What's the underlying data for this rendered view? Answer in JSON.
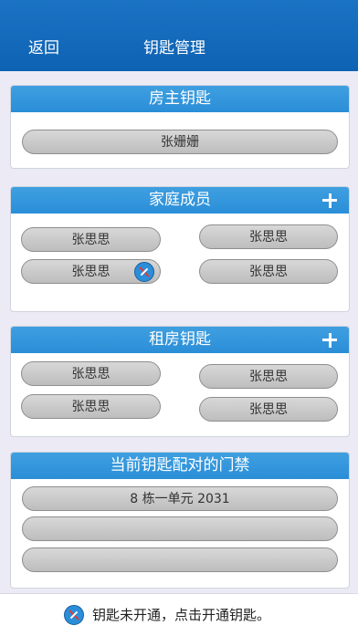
{
  "header": {
    "back_label": "返回",
    "title": "钥匙管理"
  },
  "owner_key": {
    "title": "房主钥匙",
    "members": [
      "张姗姗"
    ]
  },
  "family": {
    "title": "家庭成员",
    "members": [
      "张思思",
      "张思思",
      "张思思",
      "张思思"
    ]
  },
  "rental": {
    "title": "租房钥匙",
    "members": [
      "张思思",
      "张思思",
      "张思思",
      "张思思"
    ]
  },
  "doors": {
    "title": "当前钥匙配对的门禁",
    "items": [
      "8 栋一单元 2031",
      "",
      ""
    ]
  },
  "footer": {
    "text": "钥匙未开通，点击开通钥匙。"
  },
  "colors": {
    "header": "#1167b8",
    "bar": "#2a8ed8",
    "pill": "#c8c8c8",
    "background": "#ecebf5"
  }
}
